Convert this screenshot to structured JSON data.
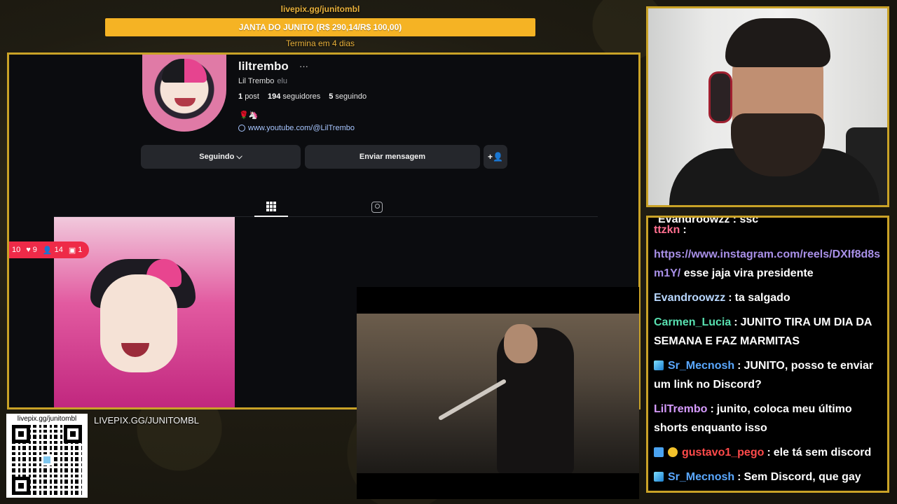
{
  "overlay": {
    "goal_url": "livepix.gg/junitombl",
    "goal_text": "JANTA DO JUNITO (R$ 290,14/R$ 100,00)",
    "goal_ends": "Termina em 4 dias",
    "livepix_label": "LIVEPIX.GG/JUNITOMBL",
    "qr_title": "livepix.gg/junitombl"
  },
  "profile": {
    "username": "liltrembo",
    "more": "···",
    "full_name": "Lil Trembo",
    "pronoun": "elu",
    "posts_count": "1",
    "posts_label": "post",
    "followers_count": "194",
    "followers_label": "seguidores",
    "following_count": "5",
    "following_label": "seguindo",
    "bio_emojis": "🌹🦄",
    "link": "www.youtube.com/@LilTrembo",
    "follow_button": "Seguindo ⌵",
    "message_button": "Enviar mensagem",
    "add_button": "+👤"
  },
  "notification": {
    "partial": "10",
    "likes": "9",
    "followers": "14",
    "tags": "1"
  },
  "chat": {
    "cut_off": "Evandroowzz : ssc",
    "messages": [
      {
        "user": "ttzkn",
        "color": "#ff6f8f",
        "badges": [],
        "text": "",
        "url": ""
      },
      {
        "user": "",
        "color": "#ffffff",
        "badges": [],
        "text": "esse jaja vira presidente",
        "url": "https://www.instagram.com/reels/DXIf8d8sm1Y/"
      },
      {
        "user": "Evandroowzz",
        "color": "#b9d8ff",
        "badges": [],
        "text": "ta salgado",
        "url": ""
      },
      {
        "user": "Carmen_Lucia",
        "color": "#58e0b0",
        "badges": [],
        "text": "JUNITO TIRA UM DIA DA SEMANA E FAZ MARMITAS",
        "url": ""
      },
      {
        "user": "Sr_Mecnosh",
        "color": "#5aa8ff",
        "badges": [
          "cube"
        ],
        "text": "JUNITO, posso te enviar um link no Discord?",
        "url": ""
      },
      {
        "user": "LilTrembo",
        "color": "#d79cff",
        "badges": [],
        "text": "junito, coloca meu último shorts enquanto isso",
        "url": ""
      },
      {
        "user": "gustavo1_pego",
        "color": "#ff4a4a",
        "badges": [
          "mod",
          "one"
        ],
        "text": "ele tá sem discord",
        "url": ""
      },
      {
        "user": "Sr_Mecnosh",
        "color": "#5aa8ff",
        "badges": [
          "cube"
        ],
        "text": "Sem Discord, que gay",
        "url": ""
      }
    ]
  }
}
